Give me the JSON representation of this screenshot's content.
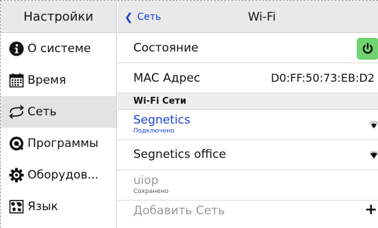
{
  "sidebar": {
    "title": "Настройки",
    "items": [
      {
        "label": "О системе",
        "icon": "info-icon"
      },
      {
        "label": "Время",
        "icon": "calendar-icon"
      },
      {
        "label": "Сеть",
        "icon": "network-icon",
        "active": true
      },
      {
        "label": "Программы",
        "icon": "programs-icon"
      },
      {
        "label": "Оборудов...",
        "icon": "gear-icon"
      },
      {
        "label": "Язык",
        "icon": "map-icon"
      }
    ]
  },
  "header": {
    "back_label": "Сеть",
    "title": "Wi-Fi"
  },
  "status": {
    "label": "Состояние",
    "icon": "power-icon",
    "accent": "#6fd36f"
  },
  "mac": {
    "label": "MAC Адрес",
    "value": "D0:FF:50:73:EB:D2"
  },
  "networks_section": {
    "title": "Wi-Fi Сети"
  },
  "networks": [
    {
      "name": "Segnetics",
      "status": "Подключено",
      "icon": "wifi-icon"
    },
    {
      "name": "Segnetics office",
      "status": "",
      "icon": "wifi-icon"
    },
    {
      "name": "uiop",
      "status": "Сохранено",
      "icon": ""
    }
  ],
  "add_network": {
    "label": "Добавить Сеть",
    "icon": "plus-icon"
  },
  "colors": {
    "link": "#1a3fd6",
    "header_bg": "#e9e9e9",
    "active_item_bg": "#e3e3e3"
  }
}
